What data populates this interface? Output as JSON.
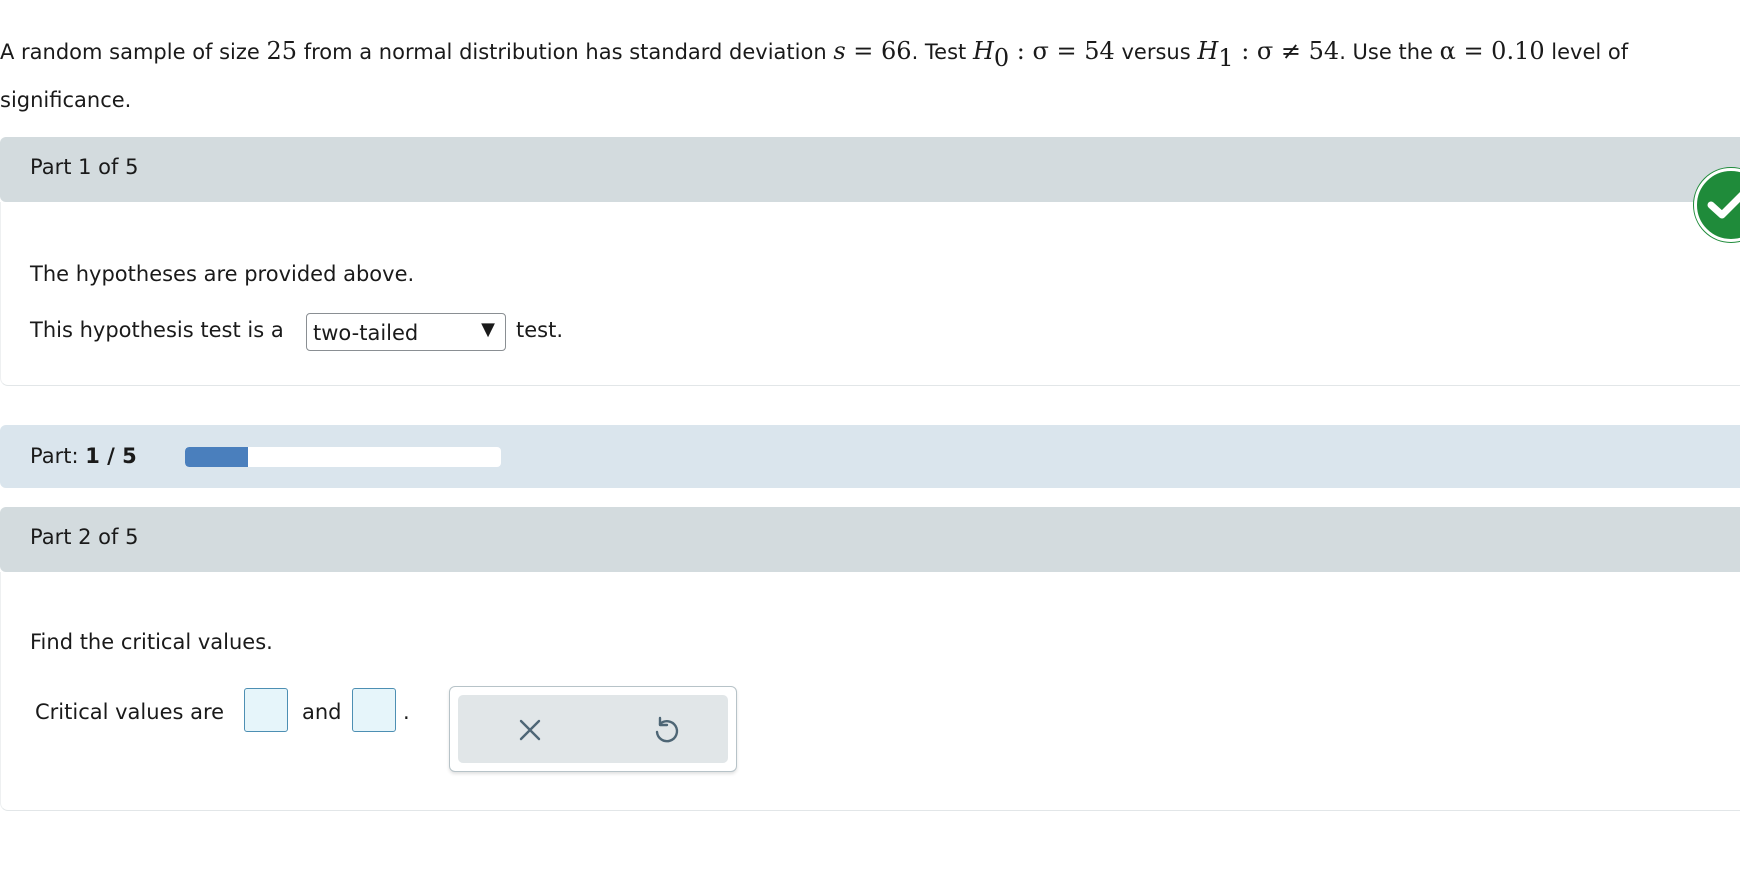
{
  "problem": {
    "t1": "A random sample of size ",
    "n": "25",
    "t2": " from a normal distribution has standard deviation ",
    "s_var": "s",
    "s_eq": " = 66",
    "t3": ". Test ",
    "h0_var": "H",
    "h0_sub": "0",
    "h0_expr": " : σ = 54",
    "t4": " versus ",
    "h1_var": "H",
    "h1_sub": "1",
    "h1_expr": " : σ ≠ 54",
    "t5": ". Use the ",
    "alpha_expr": "α = 0.10",
    "t6": " level of significance."
  },
  "part1": {
    "header": "Part 1 of 5",
    "line1": "The hypotheses are provided above.",
    "line2_prefix": "This hypothesis test is a",
    "dropdown_value": "two-tailed",
    "dropdown_arrow": "▼",
    "line2_suffix": "test.",
    "status_icon": "check-icon",
    "status_color": "#1f8b3a"
  },
  "progress": {
    "label": "Part:",
    "value": "1 / 5",
    "fraction": 0.2,
    "color": "#4a7fbd"
  },
  "part2": {
    "header": "Part 2 of 5",
    "prompt": "Find the critical values.",
    "crit_label": "Critical values are",
    "and_label": "and",
    "period": ".",
    "clear_icon": "close-icon",
    "undo_icon": "undo-icon"
  }
}
